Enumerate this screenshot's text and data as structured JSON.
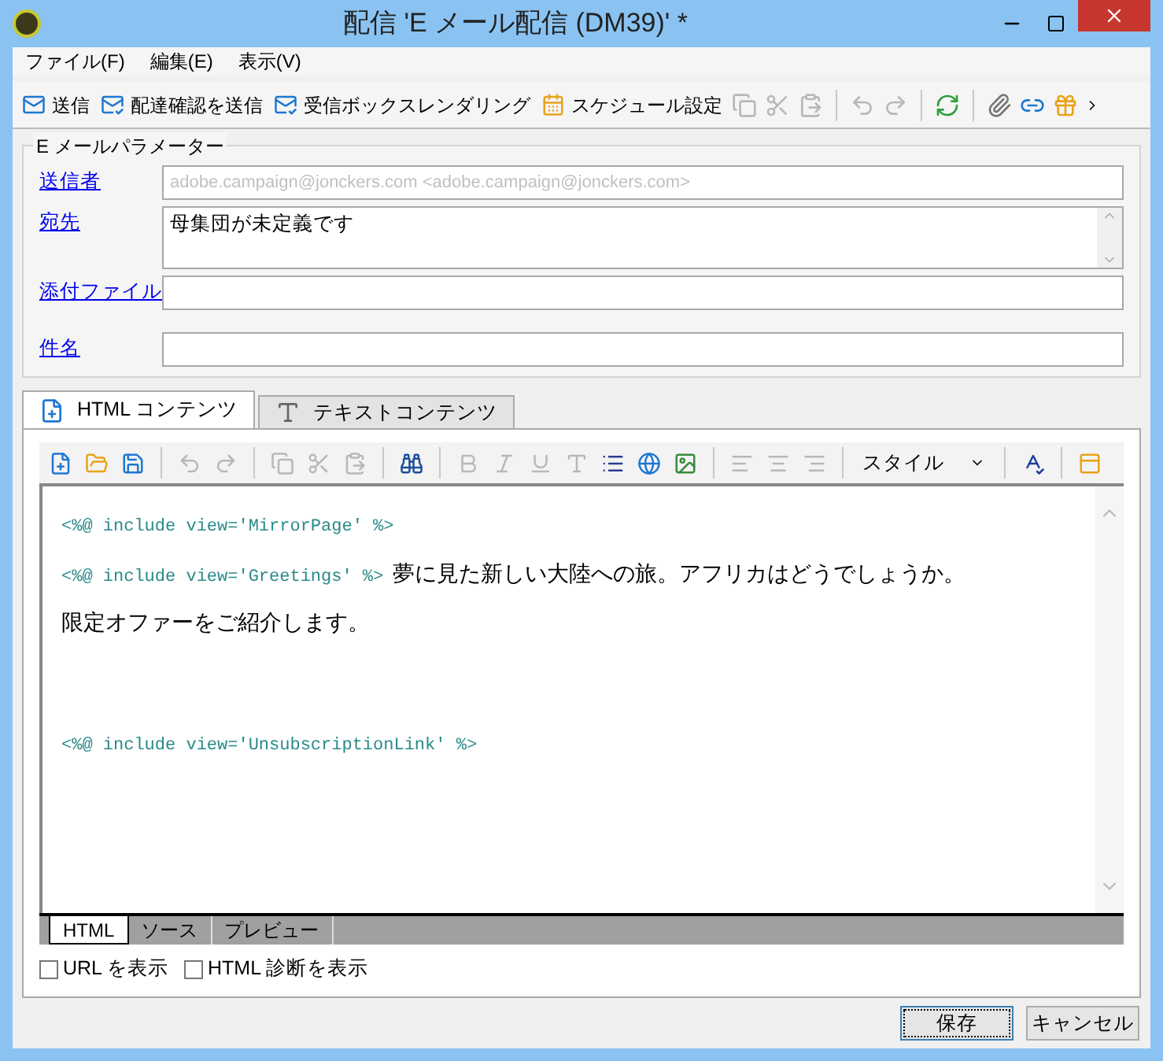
{
  "window": {
    "title": "配信 'E メール配信 (DM39)' *"
  },
  "menu": [
    "ファイル(F)",
    "編集(E)",
    "表示(V)"
  ],
  "toolbar": [
    {
      "kind": "labeled",
      "label": "送信"
    },
    {
      "kind": "labeled",
      "label": "配達確認を送信"
    },
    {
      "kind": "labeled",
      "label": "受信ボックスレンダリング"
    },
    {
      "kind": "labeled",
      "label": "スケジュール設定"
    },
    {
      "kind": "icon",
      "disabled": true
    },
    {
      "kind": "icon",
      "disabled": true
    },
    {
      "kind": "icon",
      "disabled": true
    },
    {
      "kind": "separator"
    },
    {
      "kind": "icon",
      "disabled": true
    },
    {
      "kind": "icon",
      "disabled": true
    },
    {
      "kind": "separator"
    },
    {
      "kind": "icon",
      "disabled": false
    },
    {
      "kind": "separator"
    },
    {
      "kind": "icon",
      "disabled": false
    },
    {
      "kind": "icon",
      "disabled": false
    },
    {
      "kind": "icon",
      "disabled": false
    }
  ],
  "params": {
    "title": "E メールパラメーター",
    "fields": [
      {
        "kind": "line",
        "label": "送信者",
        "value": "adobe.campaign@jonckers.com <adobe.campaign@jonckers.com>"
      },
      {
        "kind": "multiline",
        "label": "宛先",
        "value": "母集団が未定義です"
      },
      {
        "kind": "line",
        "label": "添付ファイル"
      },
      {
        "kind": "line",
        "label": "件名"
      }
    ]
  },
  "content_tabs": [
    {
      "label": "HTML コンテンツ",
      "selected": true
    },
    {
      "label": "テキストコンテンツ",
      "selected": false
    }
  ],
  "editor_toolbar": [
    {
      "kind": "icon",
      "disabled": false
    },
    {
      "kind": "icon",
      "disabled": false
    },
    {
      "kind": "icon",
      "disabled": false
    },
    {
      "kind": "separator"
    },
    {
      "kind": "icon",
      "disabled": true
    },
    {
      "kind": "icon",
      "disabled": true
    },
    {
      "kind": "separator"
    },
    {
      "kind": "icon",
      "disabled": true
    },
    {
      "kind": "icon",
      "disabled": true
    },
    {
      "kind": "icon",
      "disabled": true
    },
    {
      "kind": "separator"
    },
    {
      "kind": "icon",
      "disabled": false
    },
    {
      "kind": "separator"
    },
    {
      "kind": "icon",
      "disabled": true
    },
    {
      "kind": "icon",
      "disabled": true
    },
    {
      "kind": "icon",
      "disabled": true
    },
    {
      "kind": "icon",
      "disabled": true
    },
    {
      "kind": "icon",
      "disabled": false
    },
    {
      "kind": "icon",
      "disabled": false
    },
    {
      "kind": "icon",
      "disabled": false
    },
    {
      "kind": "separator"
    },
    {
      "kind": "icon",
      "disabled": true
    },
    {
      "kind": "icon",
      "disabled": true
    },
    {
      "kind": "icon",
      "disabled": true
    },
    {
      "kind": "separator"
    },
    {
      "kind": "dropdown",
      "label": "スタイル"
    },
    {
      "kind": "separator"
    },
    {
      "kind": "icon",
      "disabled": false
    },
    {
      "kind": "separator"
    },
    {
      "kind": "icon",
      "disabled": false
    }
  ],
  "content": [
    {
      "kind": "code",
      "code": "<%@ include view='MirrorPage' %>"
    },
    {
      "kind": "code-text",
      "code": "<%@ include view='Greetings' %>",
      "text": "夢に見た新しい大陸への旅。アフリカはどうでしょうか。"
    },
    {
      "kind": "text",
      "text": "限定オファーをご紹介します。"
    },
    {
      "kind": "code",
      "code": "<%@ include view='UnsubscriptionLink' %>"
    }
  ],
  "view_tabs": [
    {
      "label": "HTML",
      "selected": true
    },
    {
      "label": "ソース",
      "selected": false
    },
    {
      "label": "プレビュー",
      "selected": false
    }
  ],
  "options": [
    {
      "label": "URL を表示",
      "checked": false
    },
    {
      "label": "HTML 診断を表示",
      "checked": false
    }
  ],
  "buttons": [
    {
      "label": "保存",
      "focused": true
    },
    {
      "label": "キャンセル",
      "focused": false
    }
  ]
}
